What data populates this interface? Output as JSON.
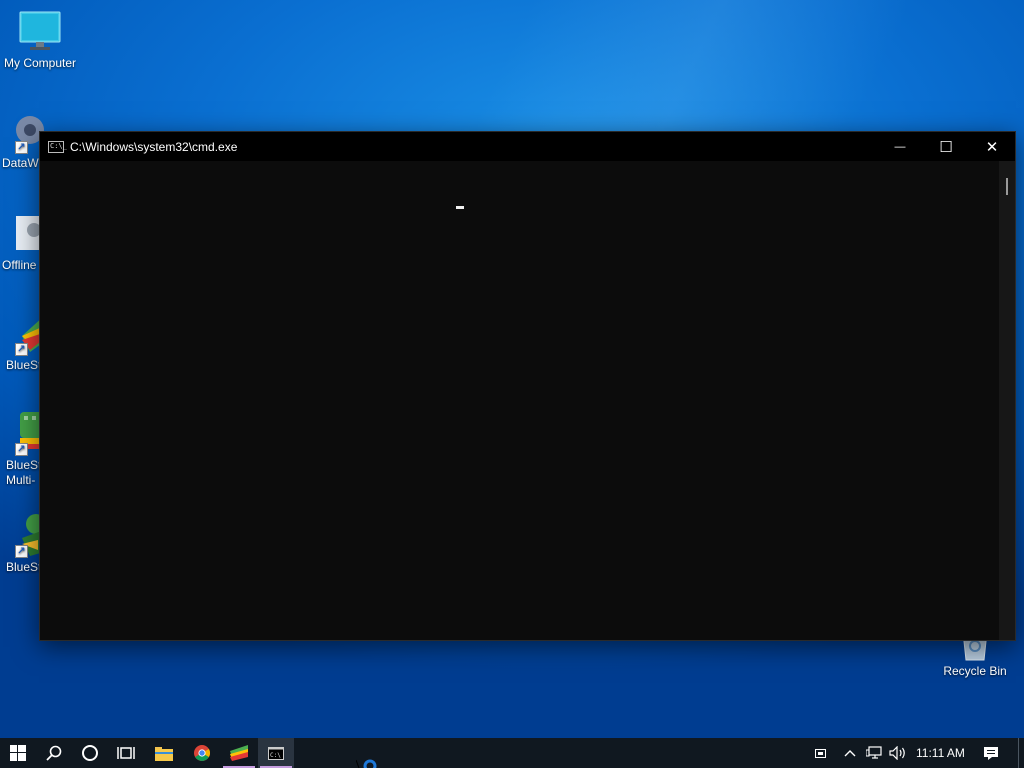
{
  "desktop": {
    "icons": [
      {
        "label": "My Computer",
        "icon": "monitor-icon"
      },
      {
        "label": "DataW",
        "icon": "gear-icon"
      },
      {
        "label": "Offline",
        "icon": "settings-icon"
      },
      {
        "label": "BlueSt",
        "icon": "bluestacks-icon"
      },
      {
        "label": "BlueSt",
        "label2": "Multi-",
        "icon": "bluestacks-multi-icon"
      },
      {
        "label": "BlueSt",
        "icon": "bluestacks-x-icon"
      },
      {
        "label": "Recycle Bin",
        "icon": "recycle-bin-icon"
      }
    ]
  },
  "cmd_window": {
    "title": "C:\\Windows\\system32\\cmd.exe",
    "icon_text": "C:\\_",
    "minimize_glyph": "—",
    "maximize_glyph": "☐",
    "close_glyph": "✕"
  },
  "taskbar": {
    "items": [
      "start-button",
      "search-button",
      "cortana-button",
      "task-view-button",
      "file-explorer",
      "chrome",
      "bluestacks",
      "cmd"
    ],
    "active_item": "cmd",
    "tray": {
      "time": "11:11 AM"
    }
  },
  "colors": {
    "desktop_blue": "#0a6fd1",
    "taskbar": "#101820",
    "cmd_background": "#0c0c0c",
    "active_indicator": "#c69de0"
  }
}
